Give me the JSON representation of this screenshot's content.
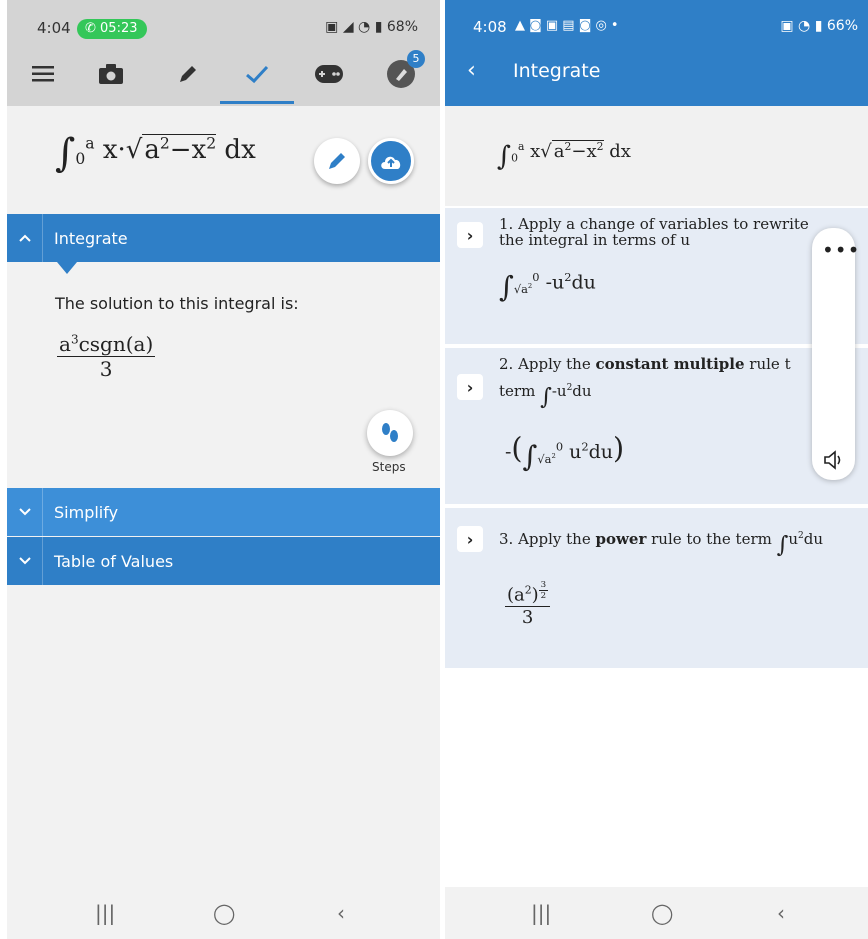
{
  "left": {
    "status": {
      "time": "4:04",
      "call": "05:23",
      "battery": "68%"
    },
    "toolbar": {
      "icons": [
        "menu-icon",
        "camera-icon",
        "pencil-icon",
        "check-icon",
        "gamepad-icon",
        "rocket-icon"
      ],
      "badge": "5"
    },
    "formula": {
      "var": "x",
      "upper": "a",
      "lower": "0",
      "a": "a",
      "exp": "2",
      "dx": "dx"
    },
    "sections": {
      "integrate": "Integrate",
      "simplify": "Simplify",
      "table": "Table of Values"
    },
    "solution_text": "The solution to this integral is:",
    "result": {
      "num": "csgn(a)",
      "a": "a",
      "exp": "3",
      "den": "3"
    },
    "steps_label": "Steps"
  },
  "right": {
    "status": {
      "time": "4:08",
      "battery": "66%"
    },
    "title": "Integrate",
    "formula": {
      "var": "x",
      "upper": "a",
      "lower": "0",
      "a": "a",
      "exp": "2",
      "dx": "dx"
    },
    "step1": {
      "line1": "1. Apply a change of variables to rewrite",
      "line2": "the integral in terms of u",
      "upper": "0",
      "lower_a": "a",
      "lower_exp": "2",
      "body": "-u",
      "exp": "2",
      "du": "du"
    },
    "step2": {
      "line1a": "2. Apply the ",
      "line1b": "constant multiple",
      "line1c": " rule t",
      "term": "term",
      "term_expr": "-u",
      "term_exp": "2",
      "term_du": "du",
      "neg": "-",
      "upper": "0",
      "lower_a": "a",
      "lower_exp": "2",
      "body": "u",
      "exp": "2",
      "du": "du"
    },
    "step3": {
      "line_a": "3. Apply the ",
      "line_b": "power",
      "line_c": " rule to the term ",
      "expr": "u",
      "exp": "2",
      "du": "du",
      "result_a": "a",
      "result_exp_in": "2",
      "result_exp_num": "3",
      "result_exp_den": "2",
      "result_den": "3"
    },
    "float_panel": {
      "more": "•••"
    }
  }
}
